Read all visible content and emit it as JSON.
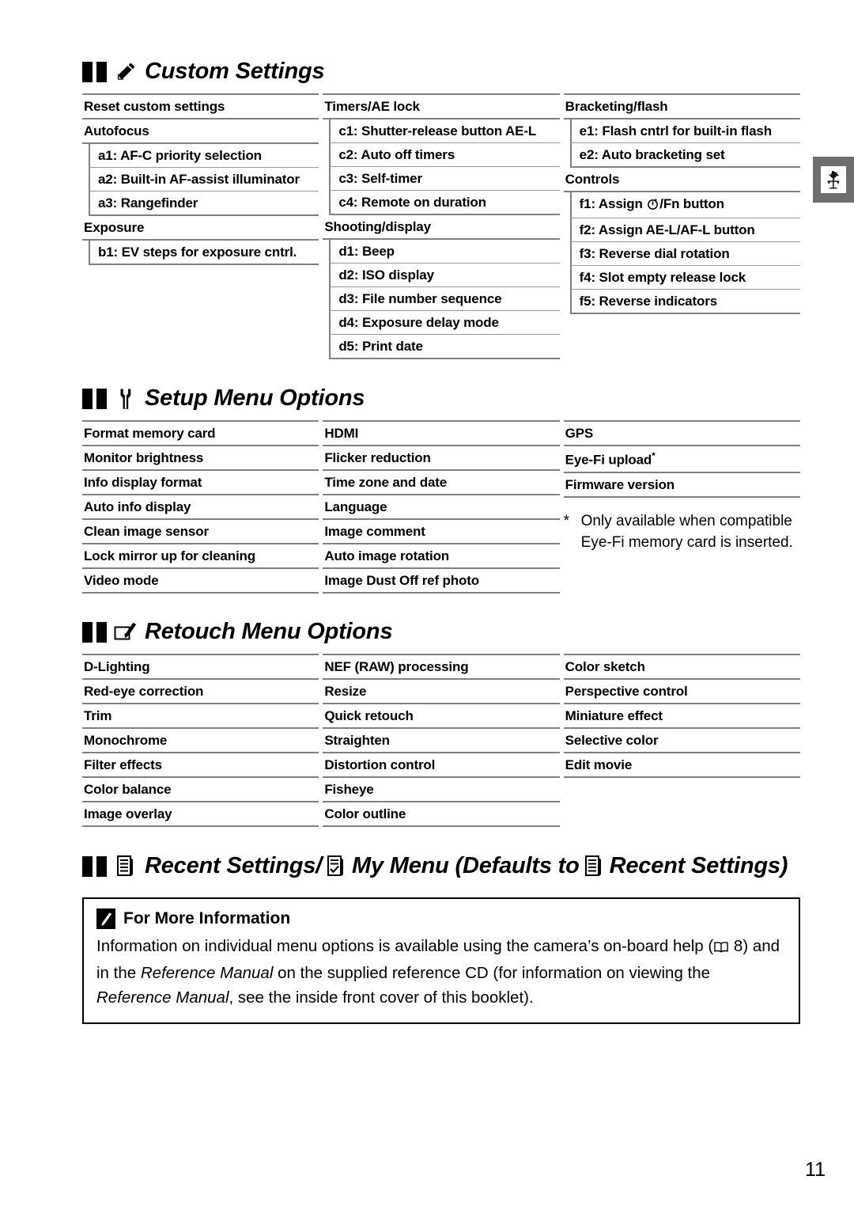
{
  "page": {
    "number": "11"
  },
  "side_tab": {
    "icon": "weathervane-rooster-icon"
  },
  "sections": [
    {
      "id": "custom-settings",
      "icon": "pencil-icon",
      "title": "Custom Settings",
      "columns": [
        {
          "rows": [
            {
              "type": "group",
              "label": "Reset custom settings"
            },
            {
              "type": "group",
              "label": "Autofocus"
            },
            {
              "type": "sub",
              "label": "a1: AF-C priority selection"
            },
            {
              "type": "sub",
              "label": "a2: Built-in AF-assist illuminator"
            },
            {
              "type": "sub",
              "label": "a3: Rangefinder",
              "last": true
            },
            {
              "type": "group",
              "label": "Exposure"
            },
            {
              "type": "sub",
              "label": "b1: EV steps for exposure cntrl.",
              "last": true
            }
          ]
        },
        {
          "rows": [
            {
              "type": "group",
              "label": "Timers/AE lock"
            },
            {
              "type": "sub",
              "label": "c1: Shutter-release button AE-L"
            },
            {
              "type": "sub",
              "label": "c2: Auto off timers"
            },
            {
              "type": "sub",
              "label": "c3: Self-timer"
            },
            {
              "type": "sub",
              "label": "c4: Remote on duration",
              "last": true
            },
            {
              "type": "group",
              "label": "Shooting/display"
            },
            {
              "type": "sub",
              "label": "d1: Beep"
            },
            {
              "type": "sub",
              "label": "d2: ISO display"
            },
            {
              "type": "sub",
              "label": "d3: File number sequence"
            },
            {
              "type": "sub",
              "label": "d4: Exposure delay mode"
            },
            {
              "type": "sub",
              "label": "d5: Print date",
              "last": true
            }
          ]
        },
        {
          "rows": [
            {
              "type": "group",
              "label": "Bracketing/flash"
            },
            {
              "type": "sub",
              "label": "e1: Flash cntrl for built-in flash"
            },
            {
              "type": "sub",
              "label": "e2: Auto bracketing set",
              "last": true
            },
            {
              "type": "group",
              "label": "Controls"
            },
            {
              "type": "sub",
              "label": "f1: Assign ",
              "icon": "self-timer-icon",
              "label_after": "/Fn button"
            },
            {
              "type": "sub",
              "label": "f2: Assign AE-L/AF-L button"
            },
            {
              "type": "sub",
              "label": "f3: Reverse dial rotation"
            },
            {
              "type": "sub",
              "label": "f4: Slot empty release lock"
            },
            {
              "type": "sub",
              "label": "f5: Reverse indicators",
              "last": true
            }
          ]
        }
      ]
    },
    {
      "id": "setup-menu-options",
      "icon": "wrench-icon",
      "title": "Setup Menu Options",
      "columns": [
        {
          "rows": [
            {
              "type": "plain",
              "label": "Format memory card"
            },
            {
              "type": "plain",
              "label": "Monitor brightness"
            },
            {
              "type": "plain",
              "label": "Info display format"
            },
            {
              "type": "plain",
              "label": "Auto info display"
            },
            {
              "type": "plain",
              "label": "Clean image sensor"
            },
            {
              "type": "plain",
              "label": "Lock mirror up for cleaning"
            },
            {
              "type": "plain",
              "label": "Video mode"
            }
          ]
        },
        {
          "rows": [
            {
              "type": "plain",
              "label": "HDMI"
            },
            {
              "type": "plain",
              "label": "Flicker reduction"
            },
            {
              "type": "plain",
              "label": "Time zone and date"
            },
            {
              "type": "plain",
              "label": "Language"
            },
            {
              "type": "plain",
              "label": "Image comment"
            },
            {
              "type": "plain",
              "label": "Auto image rotation"
            },
            {
              "type": "plain",
              "label": "Image Dust Off ref photo"
            }
          ]
        },
        {
          "rows": [
            {
              "type": "plain",
              "label": "GPS"
            },
            {
              "type": "plain",
              "label": "Eye-Fi upload",
              "asterisk": true
            },
            {
              "type": "plain",
              "label": "Firmware version"
            }
          ],
          "footnote": {
            "marker": "*",
            "text": "Only available when compatible Eye-Fi memory card is inserted."
          }
        }
      ]
    },
    {
      "id": "retouch-menu-options",
      "icon": "retouch-brush-icon",
      "title": "Retouch Menu Options",
      "columns": [
        {
          "rows": [
            {
              "type": "plain",
              "label": "D-Lighting"
            },
            {
              "type": "plain",
              "label": "Red-eye correction"
            },
            {
              "type": "plain",
              "label": "Trim"
            },
            {
              "type": "plain",
              "label": "Monochrome"
            },
            {
              "type": "plain",
              "label": "Filter effects"
            },
            {
              "type": "plain",
              "label": "Color balance"
            },
            {
              "type": "plain",
              "label": "Image overlay"
            }
          ]
        },
        {
          "rows": [
            {
              "type": "plain",
              "label": "NEF (RAW) processing"
            },
            {
              "type": "plain",
              "label": "Resize"
            },
            {
              "type": "plain",
              "label": "Quick retouch"
            },
            {
              "type": "plain",
              "label": "Straighten"
            },
            {
              "type": "plain",
              "label": "Distortion control"
            },
            {
              "type": "plain",
              "label": "Fisheye"
            },
            {
              "type": "plain",
              "label": "Color outline"
            }
          ]
        },
        {
          "rows": [
            {
              "type": "plain",
              "label": "Color sketch"
            },
            {
              "type": "plain",
              "label": "Perspective control"
            },
            {
              "type": "plain",
              "label": "Miniature effect"
            },
            {
              "type": "plain",
              "label": "Selective color"
            },
            {
              "type": "plain",
              "label": "Edit movie"
            }
          ]
        }
      ]
    }
  ],
  "recent_heading": {
    "part1": "Recent Settings/",
    "part2": "My Menu (Defaults to ",
    "part3": "Recent Settings)",
    "icon1": "recent-settings-list-icon",
    "icon2": "my-menu-checklist-icon",
    "icon3": "recent-settings-list-icon"
  },
  "note": {
    "icon": "pencil-note-icon",
    "title": "For More Information",
    "line1_a": "Information on individual menu options is available using the camera’s on-board help (",
    "line1_book_icon": "book-icon",
    "line1_b": " 8)",
    "line2_a": "and in the ",
    "line2_ital": "Reference Manual",
    "line2_b": " on the supplied reference CD (for information on viewing the",
    "line3_ital": "Reference Manual",
    "line3_b": ", see the inside front cover of this booklet)."
  }
}
